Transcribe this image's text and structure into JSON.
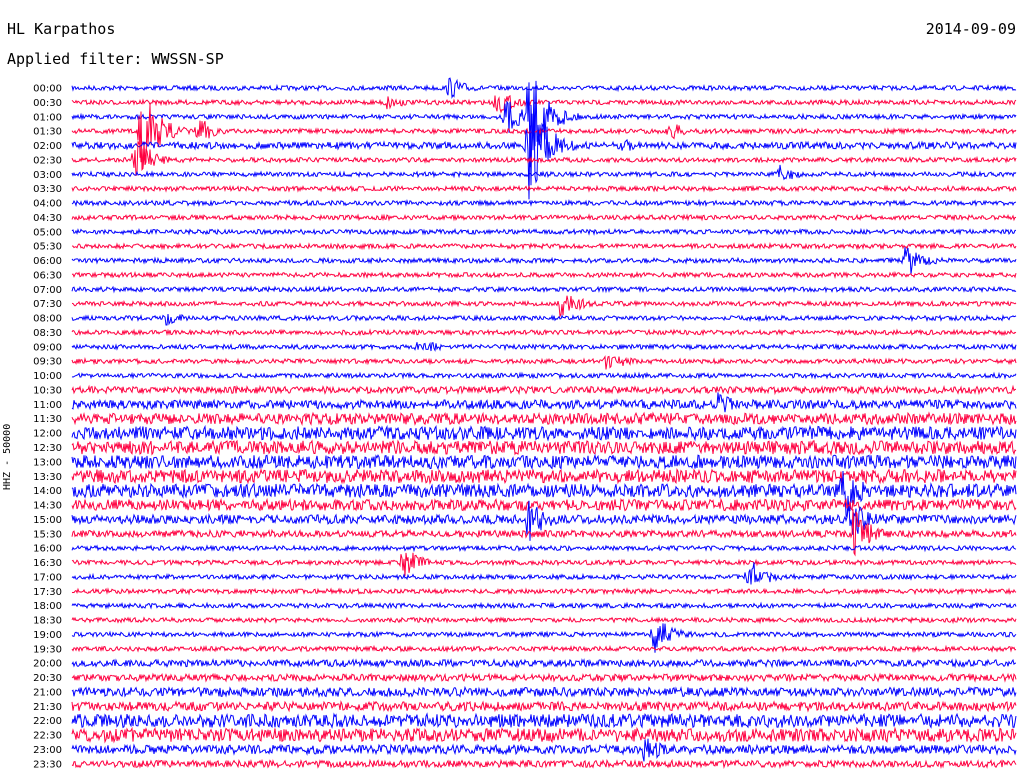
{
  "header": {
    "station": "HL Karpathos",
    "filter": "Applied filter: WWSSN-SP",
    "date": "2014-09-09"
  },
  "chart_data": {
    "type": "line",
    "title": "HL Karpathos",
    "subtitle": "Applied filter: WWSSN-SP",
    "ylabel": "HHZ - 50000",
    "xlabel": "",
    "colors": [
      "#0000ff",
      "#ff0040"
    ],
    "grid": false,
    "row_labels": [
      "00:00",
      "00:30",
      "01:00",
      "01:30",
      "02:00",
      "02:30",
      "03:00",
      "03:30",
      "04:00",
      "04:30",
      "05:00",
      "05:30",
      "06:00",
      "06:30",
      "07:00",
      "07:30",
      "08:00",
      "08:30",
      "09:00",
      "09:30",
      "10:00",
      "10:30",
      "11:00",
      "11:30",
      "12:00",
      "12:30",
      "13:00",
      "13:30",
      "14:00",
      "14:30",
      "15:00",
      "15:30",
      "16:00",
      "16:30",
      "17:00",
      "17:30",
      "18:00",
      "18:30",
      "19:00",
      "19:30",
      "20:00",
      "20:30",
      "21:00",
      "21:30",
      "22:00",
      "22:30",
      "23:00",
      "23:30"
    ],
    "noise_level": [
      1,
      1,
      1,
      1,
      2,
      1,
      1,
      1,
      1,
      1,
      1,
      1,
      1,
      1,
      1,
      1,
      1,
      1,
      1,
      1,
      1,
      2,
      3,
      4,
      5,
      5,
      5,
      5,
      5,
      4,
      3,
      2,
      1,
      1,
      1,
      1,
      1,
      1,
      1,
      1,
      2,
      2,
      3,
      3,
      5,
      5,
      3,
      2
    ],
    "events": [
      {
        "row": 0,
        "minute": 12.0,
        "amp": 12
      },
      {
        "row": 1,
        "minute": 10.0,
        "amp": 9
      },
      {
        "row": 1,
        "minute": 13.5,
        "amp": 14
      },
      {
        "row": 2,
        "minute": 13.8,
        "amp": 20
      },
      {
        "row": 2,
        "minute": 14.5,
        "amp": 60
      },
      {
        "row": 3,
        "minute": 2.2,
        "amp": 45
      },
      {
        "row": 3,
        "minute": 4.0,
        "amp": 15
      },
      {
        "row": 3,
        "minute": 19.0,
        "amp": 10
      },
      {
        "row": 4,
        "minute": 14.5,
        "amp": 60
      },
      {
        "row": 4,
        "minute": 17.5,
        "amp": 8
      },
      {
        "row": 5,
        "minute": 2.0,
        "amp": 25
      },
      {
        "row": 6,
        "minute": 22.5,
        "amp": 10
      },
      {
        "row": 12,
        "minute": 26.5,
        "amp": 20
      },
      {
        "row": 15,
        "minute": 15.5,
        "amp": 18
      },
      {
        "row": 16,
        "minute": 3.0,
        "amp": 10
      },
      {
        "row": 18,
        "minute": 11.0,
        "amp": 10
      },
      {
        "row": 19,
        "minute": 17.0,
        "amp": 12
      },
      {
        "row": 22,
        "minute": 20.5,
        "amp": 14
      },
      {
        "row": 28,
        "minute": 24.5,
        "amp": 35
      },
      {
        "row": 30,
        "minute": 14.5,
        "amp": 24
      },
      {
        "row": 30,
        "minute": 24.7,
        "amp": 25
      },
      {
        "row": 31,
        "minute": 24.8,
        "amp": 28
      },
      {
        "row": 33,
        "minute": 10.5,
        "amp": 18
      },
      {
        "row": 34,
        "minute": 21.5,
        "amp": 20
      },
      {
        "row": 38,
        "minute": 18.5,
        "amp": 22
      },
      {
        "row": 46,
        "minute": 18.2,
        "amp": 16
      }
    ]
  }
}
